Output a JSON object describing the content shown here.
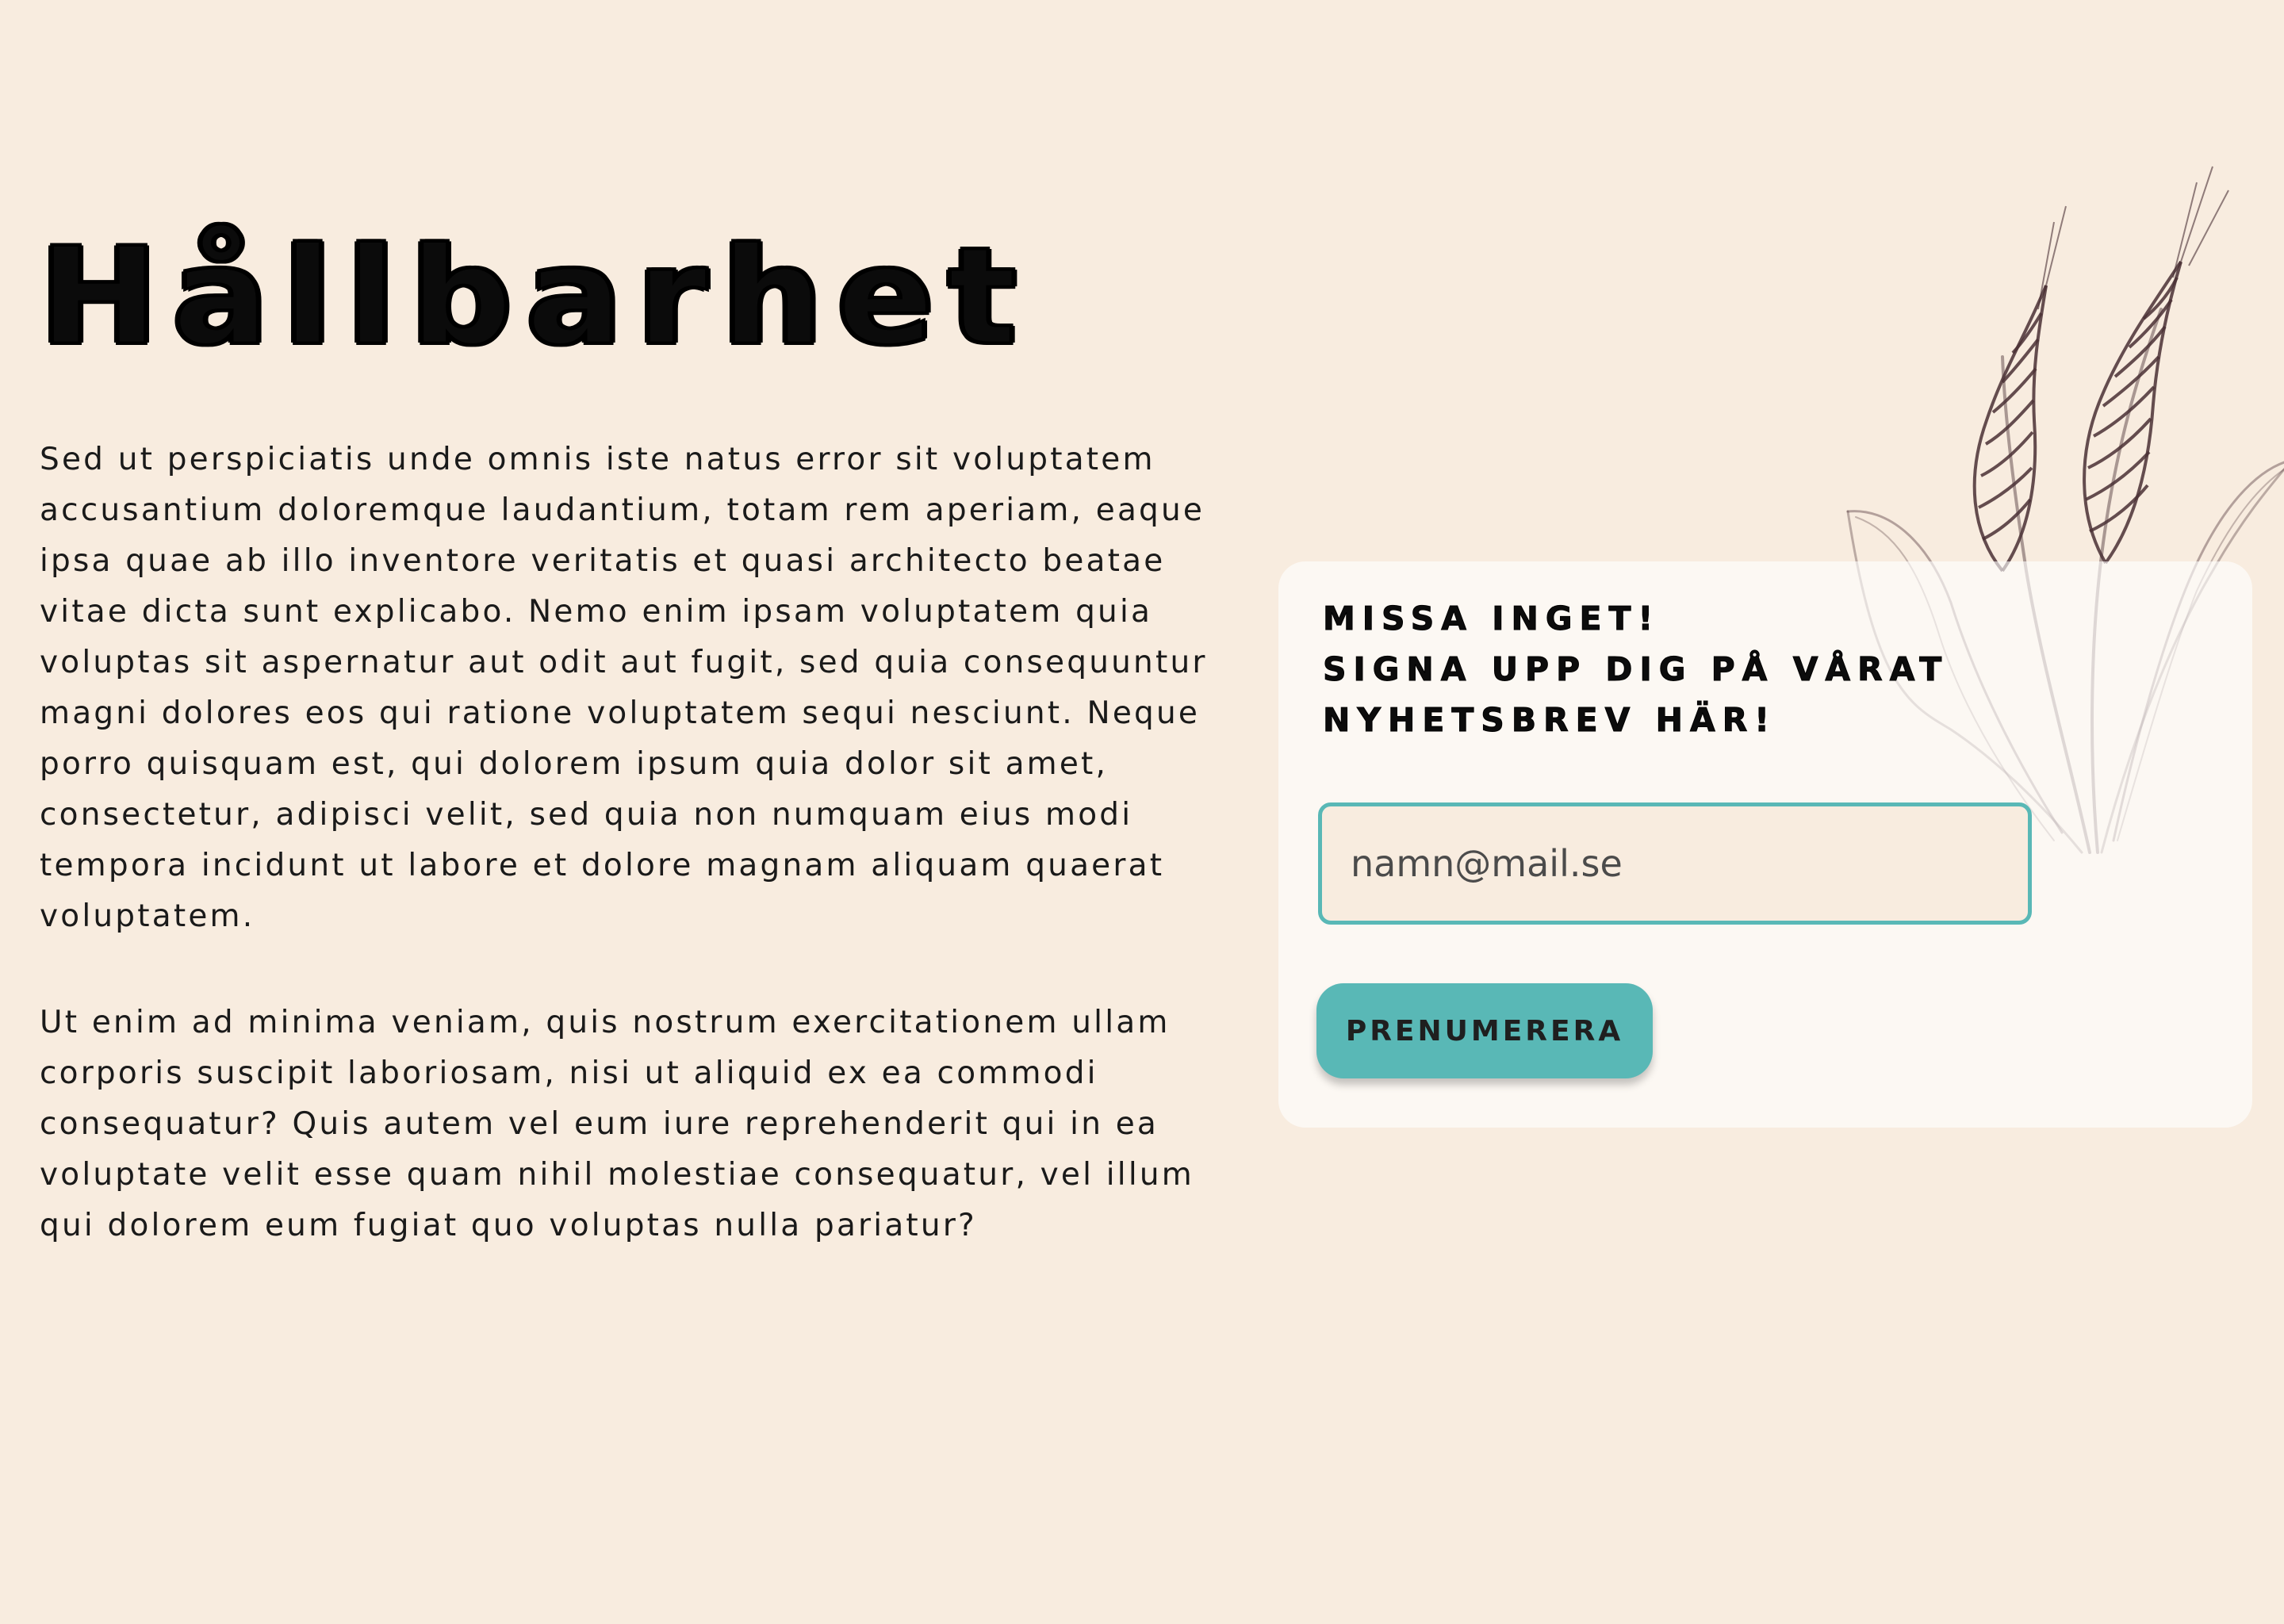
{
  "page": {
    "title": "Hållbarhet",
    "paragraphs": [
      "Sed ut perspiciatis unde omnis iste natus error sit voluptatem accusantium doloremque laudantium, totam rem aperiam, eaque ipsa quae ab illo inventore veritatis et quasi architecto beatae vitae dicta sunt explicabo. Nemo enim ipsam voluptatem quia voluptas sit aspernatur aut odit aut fugit, sed quia consequuntur magni dolores eos qui ratione voluptatem sequi nesciunt. Neque porro quisquam est, qui dolorem ipsum quia dolor sit amet, consectetur, adipisci velit, sed quia non numquam eius modi tempora incidunt ut labore et dolore magnam aliquam quaerat voluptatem.",
      "Ut enim ad minima veniam, quis nostrum exercitationem ullam corporis suscipit laboriosam, nisi ut aliquid ex ea commodi consequatur? Quis autem vel eum iure reprehenderit qui in ea voluptate velit esse quam nihil molestiae consequatur, vel illum qui dolorem eum fugiat quo voluptas nulla pariatur?"
    ]
  },
  "newsletter": {
    "heading_lines": [
      "MISSA INGET!",
      "SIGNA UPP DIG PÅ VÅRAT",
      "NYHETSBREV HÄR!"
    ],
    "email_placeholder": "namn@mail.se",
    "email_value": "",
    "subscribe_label": "PRENUMERERA",
    "decoration_icon": "wheat-icon"
  },
  "colors": {
    "background": "#f8ecdf",
    "accent": "#59b8b6",
    "card": "#fbf6f1",
    "text": "#111111",
    "wheat": "#4a3035"
  }
}
